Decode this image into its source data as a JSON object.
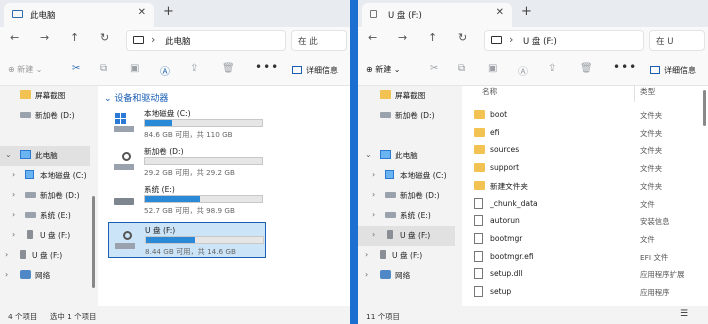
{
  "left": {
    "tab_title": "此电脑",
    "new_tab": "+",
    "close": "✕",
    "crumb": "此电脑",
    "search": "在 此",
    "new_label": "新建",
    "more": "•••",
    "details_label": "详细信息",
    "sidebar": [
      {
        "label": "屏幕截图",
        "icon": "folder-icon"
      },
      {
        "label": "新加卷 (D:)",
        "icon": "drive-icon"
      },
      {
        "label": "此电脑",
        "icon": "pc-icon",
        "expanded": true
      },
      {
        "label": "本地磁盘 (C:)",
        "icon": "windows-drive-icon"
      },
      {
        "label": "新加卷 (D:)",
        "icon": "drive-icon"
      },
      {
        "label": "系统 (E:)",
        "icon": "drive-icon"
      },
      {
        "label": "U 盘 (F:)",
        "icon": "usb-icon"
      },
      {
        "label": "U 盘 (F:)",
        "icon": "usb-icon"
      },
      {
        "label": "网络",
        "icon": "network-icon"
      }
    ],
    "group_header": "设备和驱动器",
    "drives": [
      {
        "name": "本地磁盘 (C:)",
        "size": "84.6 GB 可用，共 110 GB",
        "used": 0.23
      },
      {
        "name": "新加卷 (D:)",
        "size": "29.2 GB 可用，共 29.2 GB",
        "used": 0.0
      },
      {
        "name": "系统 (E:)",
        "size": "52.7 GB 可用，共 98.9 GB",
        "used": 0.47
      },
      {
        "name": "U 盘 (F:)",
        "size": "8.44 GB 可用，共 14.6 GB",
        "used": 0.42
      }
    ],
    "status_count": "4 个项目",
    "status_selected": "选中 1 个项目"
  },
  "right": {
    "tab_title": "U 盘 (F:)",
    "new_tab": "+",
    "close": "✕",
    "crumb": "U 盘 (F:)",
    "search": "在 U",
    "new_label": "新建",
    "more": "•••",
    "details_label": "详细信息",
    "sidebar": [
      {
        "label": "屏幕截图",
        "icon": "folder-icon"
      },
      {
        "label": "新加卷 (D:)",
        "icon": "drive-icon"
      },
      {
        "label": "此电脑",
        "icon": "pc-icon"
      },
      {
        "label": "本地磁盘 (C:)",
        "icon": "windows-drive-icon"
      },
      {
        "label": "新加卷 (D:)",
        "icon": "drive-icon"
      },
      {
        "label": "系统 (E:)",
        "icon": "drive-icon"
      },
      {
        "label": "U 盘 (F:)",
        "icon": "usb-icon"
      },
      {
        "label": "U 盘 (F:)",
        "icon": "usb-icon"
      },
      {
        "label": "网络",
        "icon": "network-icon"
      }
    ],
    "columns": {
      "name": "名称",
      "type": "类型"
    },
    "files": [
      {
        "name": "boot",
        "type": "文件夹",
        "kind": "folder"
      },
      {
        "name": "efi",
        "type": "文件夹",
        "kind": "folder"
      },
      {
        "name": "sources",
        "type": "文件夹",
        "kind": "folder"
      },
      {
        "name": "support",
        "type": "文件夹",
        "kind": "folder"
      },
      {
        "name": "新建文件夹",
        "type": "文件夹",
        "kind": "folder"
      },
      {
        "name": "_chunk_data",
        "type": "文件",
        "kind": "file"
      },
      {
        "name": "autorun",
        "type": "安装信息",
        "kind": "file"
      },
      {
        "name": "bootmgr",
        "type": "文件",
        "kind": "file"
      },
      {
        "name": "bootmgr.efi",
        "type": "EFI 文件",
        "kind": "file"
      },
      {
        "name": "setup.dll",
        "type": "应用程序扩展",
        "kind": "file"
      },
      {
        "name": "setup",
        "type": "应用程序",
        "kind": "file"
      }
    ],
    "status_count": "11 个项目"
  }
}
